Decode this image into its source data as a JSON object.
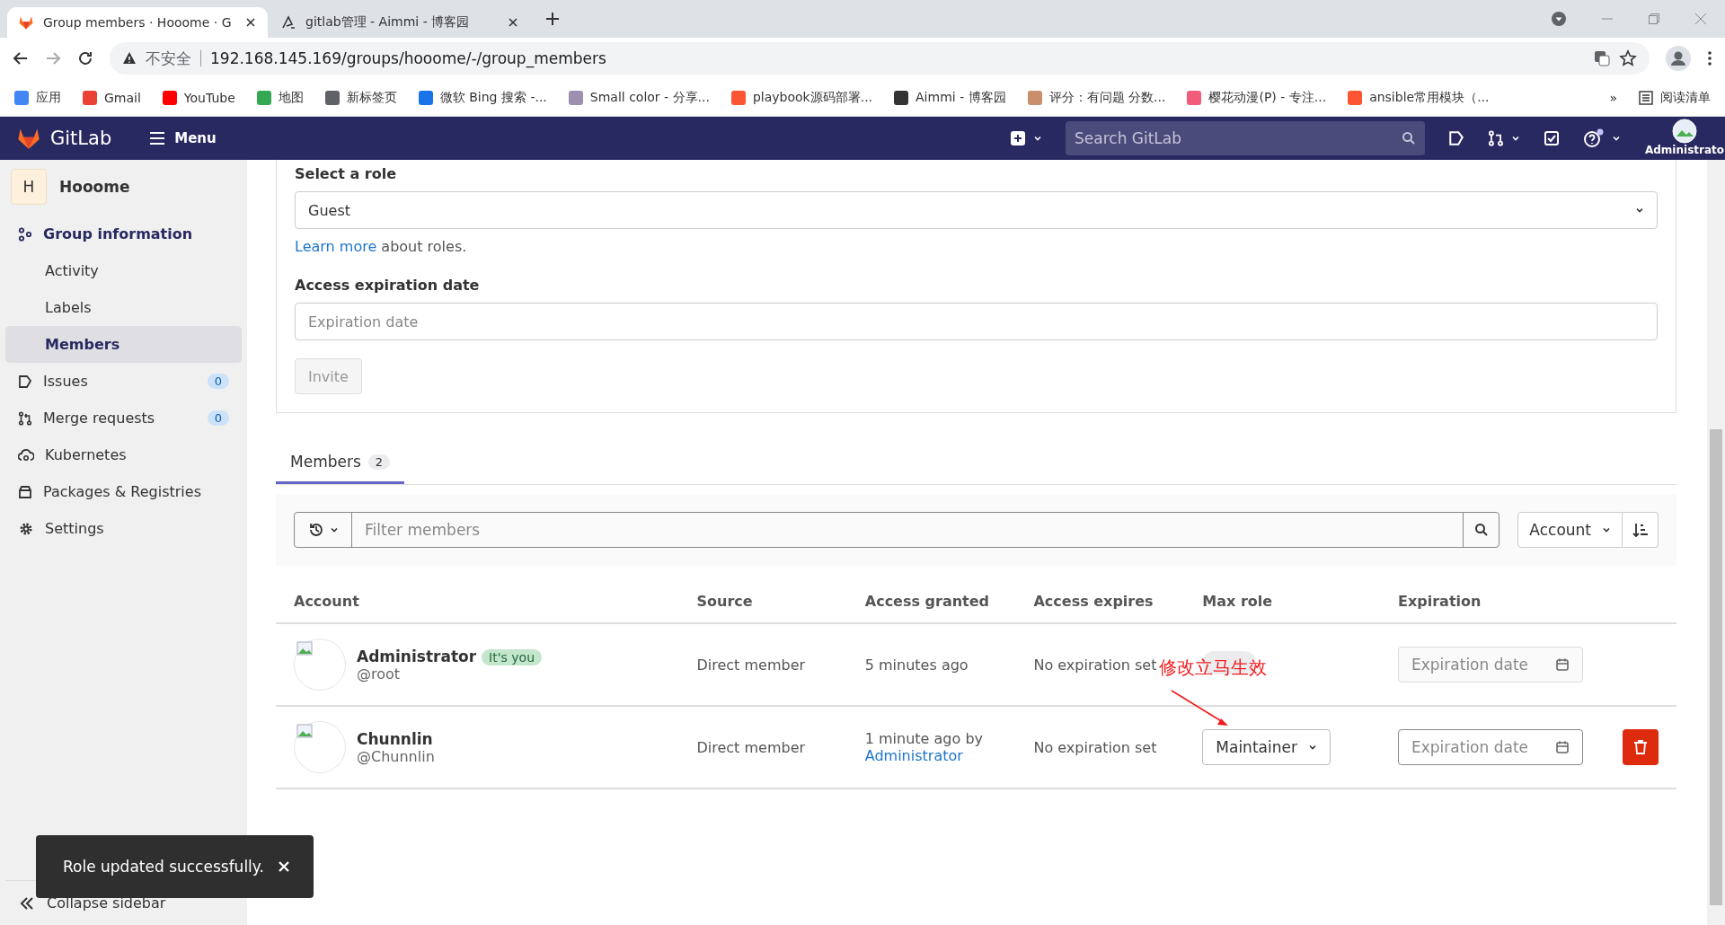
{
  "browser": {
    "tabs": [
      {
        "title": "Group members · Hooome · G",
        "selected": true
      },
      {
        "title": "gitlab管理 - Aimmi - 博客园",
        "selected": false
      }
    ],
    "address": {
      "security": "不安全",
      "url": "192.168.145.169/groups/hooome/-/group_members"
    },
    "bookmarks": [
      {
        "label": "应用",
        "color": "#4285f4"
      },
      {
        "label": "Gmail",
        "color": "#ea4335"
      },
      {
        "label": "YouTube",
        "color": "#ff0000"
      },
      {
        "label": "地图",
        "color": "#34a853"
      },
      {
        "label": "新标签页",
        "color": "#5f6368"
      },
      {
        "label": "微软 Bing 搜索 -...",
        "color": "#1a73e8"
      },
      {
        "label": "Small color - 分享...",
        "color": "#9e8fb0"
      },
      {
        "label": "playbook源码部署...",
        "color": "#fc5531"
      },
      {
        "label": "Aimmi - 博客园",
        "color": "#333333"
      },
      {
        "label": "评分：有问题 分数...",
        "color": "#c98f6a"
      },
      {
        "label": "樱花动漫(P) - 专注...",
        "color": "#f25c7a"
      },
      {
        "label": "ansible常用模块（...",
        "color": "#fc5531"
      }
    ],
    "more": "»",
    "reading_list": "阅读清单"
  },
  "header": {
    "brand": "GitLab",
    "menu": "Menu",
    "search": {
      "placeholder": "Search GitLab"
    },
    "user": "Administrato"
  },
  "sidebar": {
    "group": {
      "initial": "H",
      "name": "Hooome"
    },
    "items": [
      {
        "kind": "section",
        "label": "Group information",
        "selected": false
      },
      {
        "kind": "sub",
        "label": "Activity",
        "selected": false
      },
      {
        "kind": "sub",
        "label": "Labels",
        "selected": false
      },
      {
        "kind": "sub",
        "label": "Members",
        "selected": true
      },
      {
        "kind": "issues",
        "label": "Issues",
        "badge": "0",
        "selected": false
      },
      {
        "kind": "merge",
        "label": "Merge requests",
        "badge": "0",
        "selected": false
      },
      {
        "kind": "kubernetes",
        "label": "Kubernetes",
        "selected": false
      },
      {
        "kind": "packages",
        "label": "Packages & Registries",
        "selected": false
      },
      {
        "kind": "settings",
        "label": "Settings",
        "selected": false
      }
    ],
    "collapse": "Collapse sidebar"
  },
  "invite": {
    "role_label": "Select a role",
    "role_value": "Guest",
    "learn_more": "Learn more",
    "learn_more_rest": "about roles.",
    "expiration_label": "Access expiration date",
    "expiration": {
      "placeholder": "Expiration date"
    },
    "button": {
      "label": "Invite",
      "disabled": true
    }
  },
  "members_tab": {
    "label": "Members",
    "count": "2",
    "selected": true
  },
  "filter": {
    "placeholder": "Filter members",
    "sort": "Account"
  },
  "table": {
    "columns": [
      "Account",
      "Source",
      "Access granted",
      "Access expires",
      "Max role",
      "Expiration"
    ],
    "rows": [
      {
        "name": "Administrator",
        "badge": "It's you",
        "username": "@root",
        "source": "Direct member",
        "granted": "5 minutes ago",
        "expires": "No expiration set",
        "role": {
          "kind": "badge"
        },
        "expiration": {
          "placeholder": "Expiration date",
          "disabled": true
        },
        "removable": false
      },
      {
        "name": "Chunnlin",
        "username": "@Chunnlin",
        "source": "Direct member",
        "granted": "1 minute ago by",
        "granted_by": "Administrator",
        "expires": "No expiration set",
        "role": {
          "kind": "dropdown",
          "label": "Maintainer"
        },
        "expiration": {
          "placeholder": "Expiration date",
          "disabled": false
        },
        "removable": true
      }
    ]
  },
  "annotation": "修改立马生效",
  "toast": {
    "message": "Role updated successfully."
  }
}
